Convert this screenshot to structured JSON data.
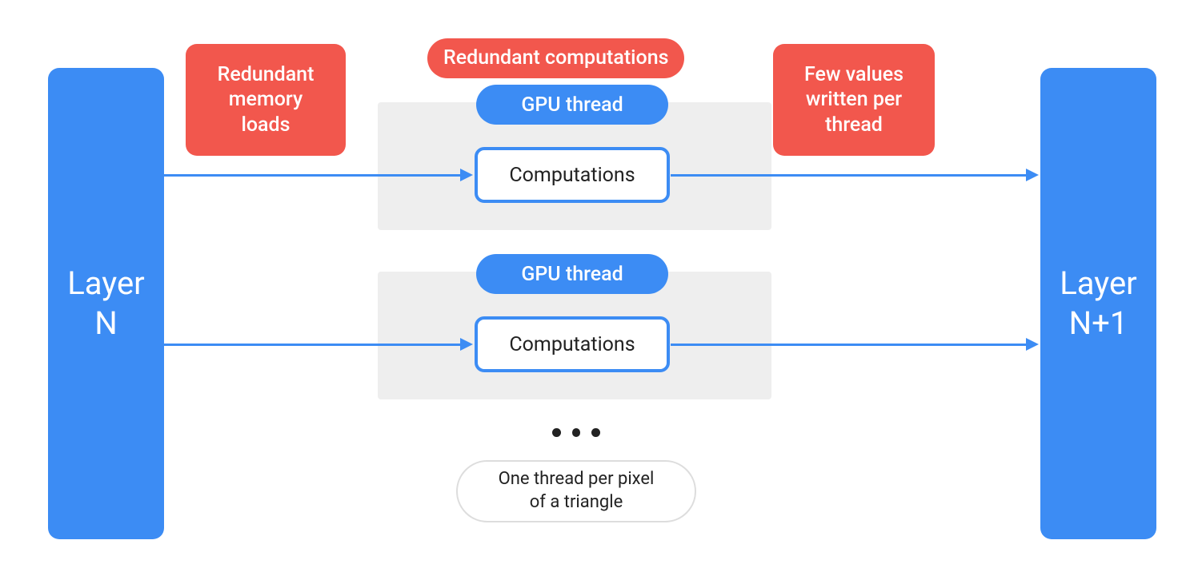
{
  "colors": {
    "blue": "#3c8cf4",
    "red": "#f2574d",
    "grey": "#eeeeee"
  },
  "layer_left": {
    "label": "Layer\nN"
  },
  "layer_right": {
    "label": "Layer\nN+1"
  },
  "callouts": {
    "redundant_memory": "Redundant\nmemory\nloads",
    "redundant_computations": "Redundant computations",
    "few_values": "Few values\nwritten per\nthread"
  },
  "threads": {
    "pill_label": "GPU thread",
    "box_label": "Computations"
  },
  "footer": {
    "dots": "•••",
    "note": "One thread per pixel\nof a triangle"
  },
  "chart_data": {
    "type": "diagram",
    "title": "GPU thread layer computation flow",
    "nodes": [
      {
        "id": "layerN",
        "label": "Layer N",
        "kind": "layer"
      },
      {
        "id": "thread1",
        "label": "GPU thread",
        "kind": "thread",
        "contains": "Computations"
      },
      {
        "id": "thread2",
        "label": "GPU thread",
        "kind": "thread",
        "contains": "Computations"
      },
      {
        "id": "ellipsis",
        "label": "One thread per pixel of a triangle",
        "kind": "note"
      },
      {
        "id": "layerN1",
        "label": "Layer N+1",
        "kind": "layer"
      }
    ],
    "edges": [
      {
        "from": "layerN",
        "to": "thread1"
      },
      {
        "from": "thread1",
        "to": "layerN1"
      },
      {
        "from": "layerN",
        "to": "thread2"
      },
      {
        "from": "thread2",
        "to": "layerN1"
      }
    ],
    "annotations": [
      {
        "text": "Redundant memory loads",
        "near": "edge layerN→threads",
        "color": "red"
      },
      {
        "text": "Redundant computations",
        "near": "threads",
        "color": "red"
      },
      {
        "text": "Few values written per thread",
        "near": "edge threads→layerN+1",
        "color": "red"
      }
    ]
  }
}
